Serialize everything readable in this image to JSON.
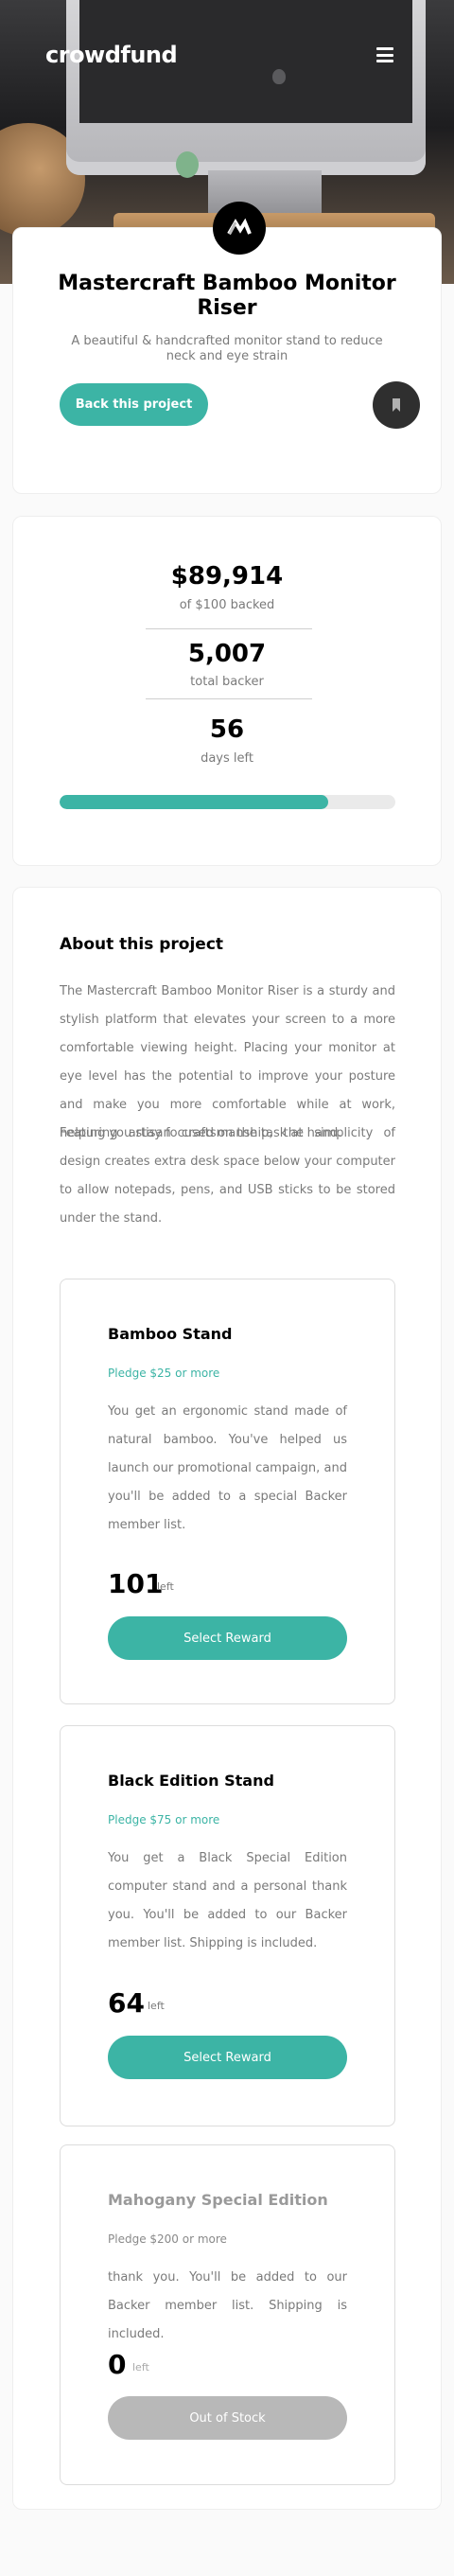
{
  "brand": {
    "logo_text": "crowdfund"
  },
  "project": {
    "title": "Mastercraft Bamboo Monitor Riser",
    "subtitle": "A beautiful & handcrafted monitor stand to reduce neck and eye strain",
    "back_button_label": "Back this project"
  },
  "stats": {
    "backed_amount": "$89,914",
    "backed_label": "of $100 backed",
    "backers_count": "5,007",
    "backers_label": "total backer",
    "days_count": "56",
    "days_label": "days left",
    "progress_fraction": 0.8
  },
  "about": {
    "heading": "About this project",
    "paragraph1": "The Mastercraft Bamboo Monitor Riser is a sturdy and stylish platform that elevates your screen to a more comfortable viewing height. Placing your monitor at eye level has the potential to improve your posture and make you more comfortable while at work, helping you stay focused on the task at hand.",
    "paragraph2": "Featuring artisan craftsmanship, the simplicity of design creates extra desk space below your computer to allow notepads, pens, and USB sticks to be stored under the stand."
  },
  "pledges": [
    {
      "name": "Bamboo Stand",
      "amount": "Pledge $25 or more",
      "description": "You get an ergonomic stand made of natural bamboo. You've helped us launch our promotional campaign, and you'll be added to a special Backer member list.",
      "left_count": "101",
      "left_word": "left",
      "button_label": "Select Reward"
    },
    {
      "name": "Black Edition Stand",
      "amount": "Pledge $75 or more",
      "description": "You get a Black Special Edition computer stand and a personal thank you. You'll be added to our Backer member list. Shipping is included.",
      "left_count": "64",
      "left_word": "left",
      "button_label": "Select Reward"
    },
    {
      "name": "Mahogany Special Edition",
      "amount": "Pledge $200 or more",
      "description": "thank you. You'll be added to our Backer member list. Shipping is included.",
      "left_count": "0",
      "left_word": "left",
      "button_label": "Out of Stock"
    }
  ],
  "colors": {
    "accent": "#3cb4a5",
    "disabled": "#b8b8b8",
    "dark": "#2f2f2f"
  },
  "icons": {
    "menu": "hamburger-icon",
    "bookmark": "bookmark-icon",
    "project_logo": "mastercraft-logo-icon"
  }
}
